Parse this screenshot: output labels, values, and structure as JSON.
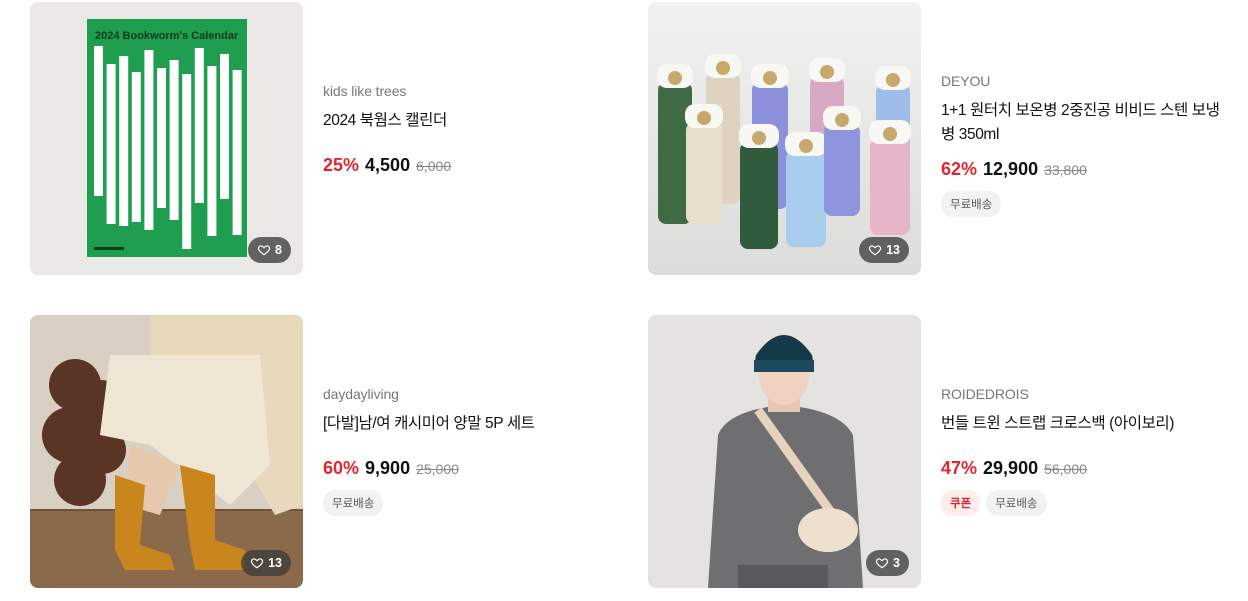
{
  "products": [
    {
      "brand": "kids like trees",
      "title": "2024 북웜스 캘린더",
      "discount": "25%",
      "price": "4,500",
      "original_price": "6,000",
      "likes": "8",
      "tags": [],
      "image_text": "2024 Bookworm's Calendar"
    },
    {
      "brand": "DEYOU",
      "title": "1+1 원터치 보온병 2중진공 비비드 스텐 보냉병 350ml",
      "discount": "62%",
      "price": "12,900",
      "original_price": "33,800",
      "likes": "13",
      "tags": [
        "무료배송"
      ]
    },
    {
      "brand": "daydayliving",
      "title": "[다발]남/여 캐시미어 양말 5P 세트",
      "discount": "60%",
      "price": "9,900",
      "original_price": "25,000",
      "likes": "13",
      "tags": [
        "무료배송"
      ]
    },
    {
      "brand": "ROIDEDROIS",
      "title": "번들 트윈 스트랩 크로스백 (아이보리)",
      "discount": "47%",
      "price": "29,900",
      "original_price": "56,000",
      "likes": "3",
      "tags": [
        "쿠폰",
        "무료배송"
      ]
    }
  ],
  "colors": {
    "discount": "#e0262e",
    "calendar_green": "#1e9e4e",
    "like_badge": "#3c3c3c"
  }
}
